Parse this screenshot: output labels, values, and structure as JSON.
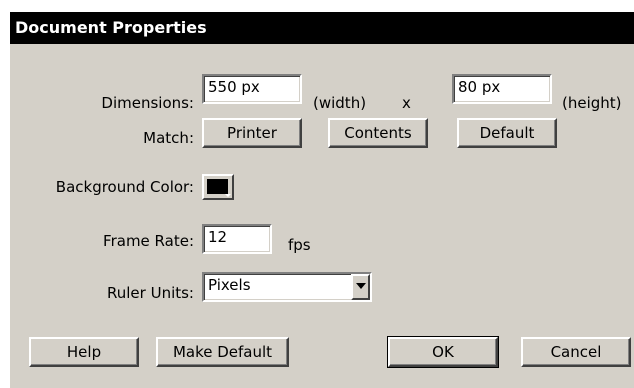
{
  "dialog": {
    "title": "Document Properties"
  },
  "dimensions": {
    "label": "Dimensions:",
    "width_value": "550 px",
    "width_suffix": "(width)",
    "separator": "x",
    "height_value": "80 px",
    "height_suffix": "(height)"
  },
  "match": {
    "label": "Match:",
    "printer_label": "Printer",
    "contents_label": "Contents",
    "default_label": "Default"
  },
  "background": {
    "label": "Background Color:",
    "color": "#000000"
  },
  "frame_rate": {
    "label": "Frame Rate:",
    "value": "12",
    "unit": "fps"
  },
  "ruler_units": {
    "label": "Ruler Units:",
    "selected": "Pixels"
  },
  "footer": {
    "help_label": "Help",
    "make_default_label": "Make Default",
    "ok_label": "OK",
    "cancel_label": "Cancel"
  }
}
